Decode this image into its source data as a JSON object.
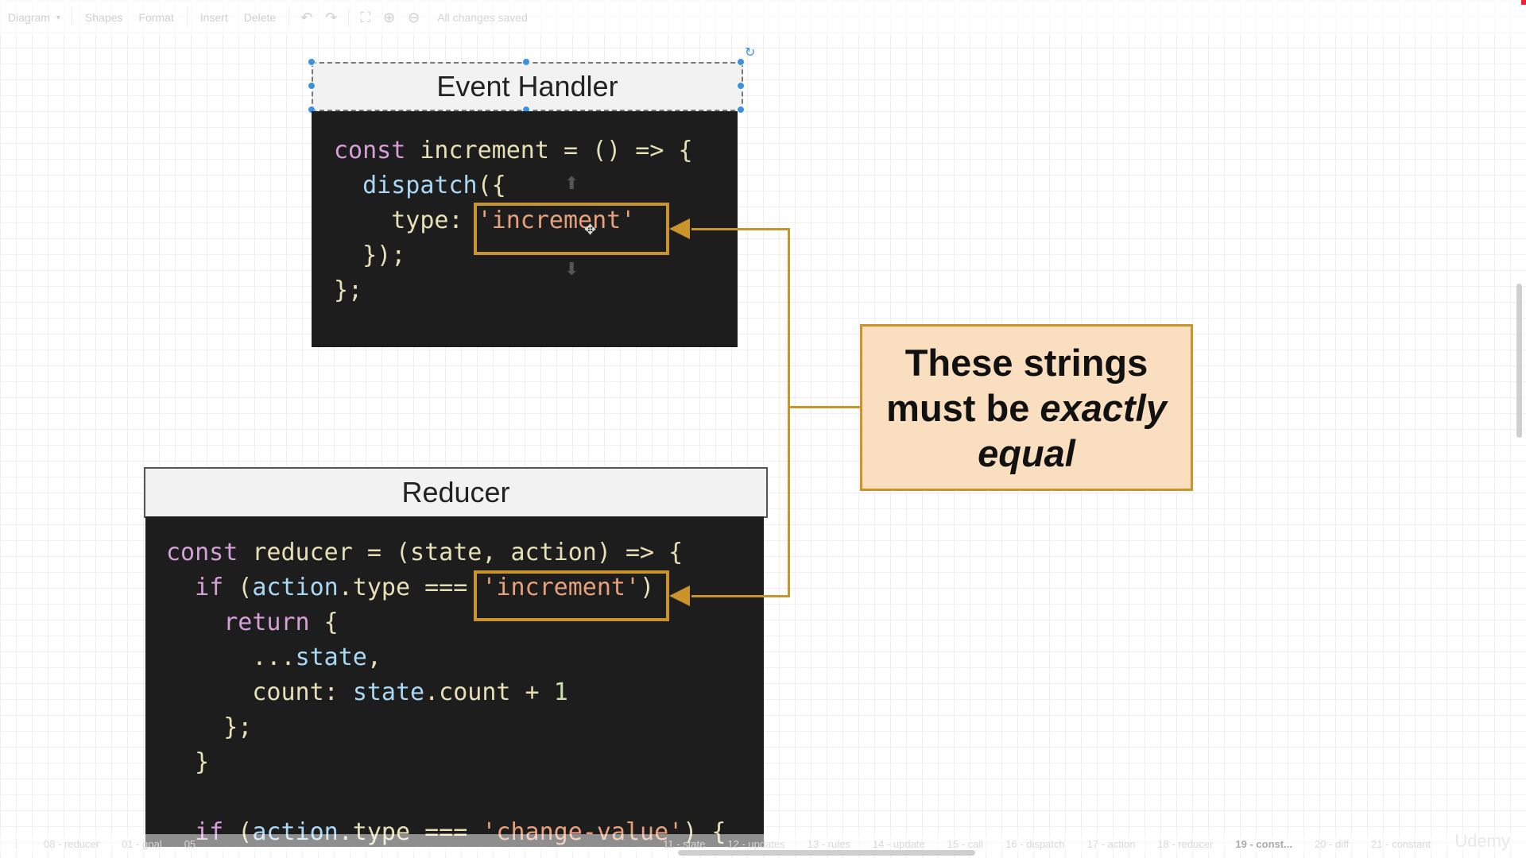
{
  "toolbar": {
    "diagram": "Diagram",
    "shapes": "Shapes",
    "format": "Format",
    "insert": "Insert",
    "delete": "Delete",
    "status": "All changes saved"
  },
  "event_handler": {
    "title": "Event Handler",
    "lines": [
      [
        [
          "kw",
          "const"
        ],
        [
          "p",
          " increment = () => {"
        ]
      ],
      [
        [
          "p",
          "  "
        ],
        [
          "fn",
          "dispatch"
        ],
        [
          "p",
          "({"
        ]
      ],
      [
        [
          "p",
          "    type: "
        ],
        [
          "str",
          "'increment'"
        ]
      ],
      [
        [
          "p",
          "  });"
        ]
      ],
      [
        [
          "p",
          "};"
        ]
      ]
    ]
  },
  "reducer": {
    "title": "Reducer",
    "lines": [
      [
        [
          "kw",
          "const"
        ],
        [
          "p",
          " reducer = (state, action) => {"
        ]
      ],
      [
        [
          "p",
          "  "
        ],
        [
          "kw",
          "if"
        ],
        [
          "p",
          " ("
        ],
        [
          "fn",
          "action"
        ],
        [
          "p",
          ".type === "
        ],
        [
          "str",
          "'increment'"
        ],
        [
          "p",
          ")"
        ]
      ],
      [
        [
          "p",
          "    "
        ],
        [
          "kw",
          "return"
        ],
        [
          "p",
          " {"
        ]
      ],
      [
        [
          "p",
          "      ..."
        ],
        [
          "fn",
          "state"
        ],
        [
          "p",
          ","
        ]
      ],
      [
        [
          "p",
          "      count: "
        ],
        [
          "fn",
          "state"
        ],
        [
          "p",
          ".count + "
        ],
        [
          "num",
          "1"
        ]
      ],
      [
        [
          "p",
          "    };"
        ]
      ],
      [
        [
          "p",
          "  }"
        ]
      ],
      [
        [
          "p",
          ""
        ]
      ],
      [
        [
          "p",
          "  "
        ],
        [
          "kw",
          "if"
        ],
        [
          "p",
          " ("
        ],
        [
          "fn",
          "action"
        ],
        [
          "p",
          ".type === "
        ],
        [
          "str",
          "'change-value'"
        ],
        [
          "p",
          ") {"
        ]
      ]
    ]
  },
  "note": {
    "line1": "These strings",
    "line2a": "must be ",
    "line2b": "exactly",
    "line3": "equal"
  },
  "bottom_tabs": [
    "08 - reducer",
    "01 - goal",
    "05",
    "11 - state",
    "12 - updates",
    "13 - rules",
    "14 - update",
    "15 - call",
    "16 - dispatch",
    "17 - action",
    "18 - reducer",
    "19 - const...",
    "20 - diff",
    "21 - constant"
  ],
  "active_tab": "19 - const...",
  "watermark": "Udemy",
  "colors": {
    "accent": "#c9952a",
    "note_bg": "#f9dfc0",
    "code_bg": "#1d1d1d",
    "handle": "#3d8fe0"
  }
}
